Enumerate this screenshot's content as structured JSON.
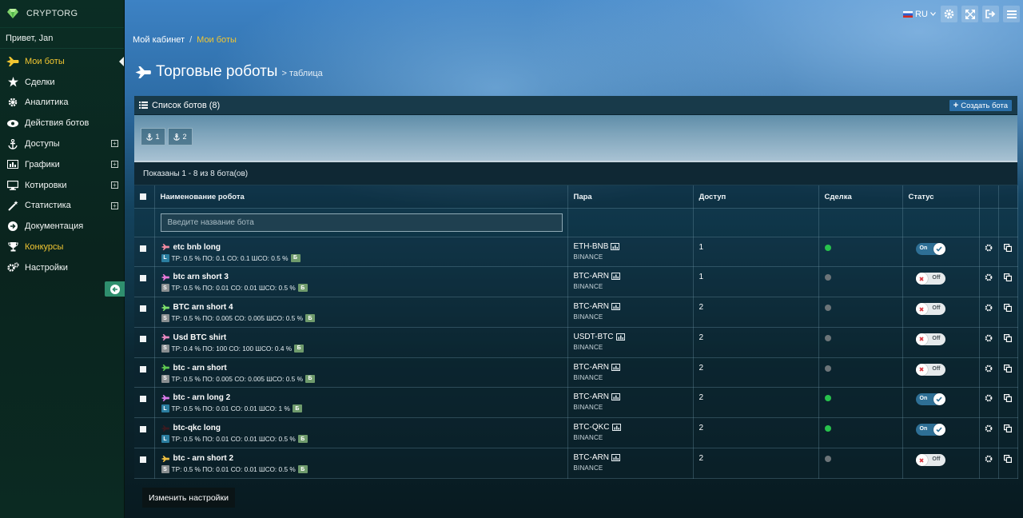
{
  "brand": {
    "name": "CRYPTORG"
  },
  "user": {
    "greeting": "Привет, Jan"
  },
  "sidebar": {
    "items": [
      {
        "label": "Мои боты"
      },
      {
        "label": "Сделки"
      },
      {
        "label": "Аналитика"
      },
      {
        "label": "Действия ботов"
      },
      {
        "label": "Доступы"
      },
      {
        "label": "Графики"
      },
      {
        "label": "Котировки"
      },
      {
        "label": "Статистика"
      },
      {
        "label": "Документация"
      },
      {
        "label": "Конкурсы"
      },
      {
        "label": "Настройки"
      }
    ]
  },
  "topbar": {
    "lang": "RU"
  },
  "breadcrumb": {
    "home": "Мой кабинет",
    "sep": "/",
    "current": "Мои боты"
  },
  "page": {
    "title": "Торговые роботы",
    "subtitle": "> таблица"
  },
  "panel": {
    "title": "Список ботов (8)",
    "create_label": "Создать бота",
    "groups": [
      {
        "label": "1"
      },
      {
        "label": "2"
      }
    ],
    "shown_text": "Показаны 1 - 8 из 8 бота(ов)",
    "apply_label": "Изменить настройки"
  },
  "table": {
    "headers": {
      "name": "Наименование робота",
      "pair": "Пара",
      "access": "Доступ",
      "deal": "Сделка",
      "status": "Статус"
    },
    "search_placeholder": "Введите название бота",
    "rows": [
      {
        "name": "etc bnb long",
        "side": "L",
        "params": "TP: 0.5 % ПО: 0.1 СО: 0.1 ШСО: 0.5 %",
        "badge": "Б",
        "pair": "ETH-BNB",
        "exchange": "BINANCE",
        "access": "1",
        "deal_color": "#27c24c",
        "status": "On",
        "plane_color": "#f08aa0"
      },
      {
        "name": "btc arn short 3",
        "side": "S",
        "params": "TP: 0.5 % ПО: 0.01 СО: 0.01 ШСО: 0.5 %",
        "badge": "Б",
        "pair": "BTC-ARN",
        "exchange": "BINANCE",
        "access": "1",
        "deal_color": "#6c7478",
        "status": "Off",
        "plane_color": "#e878d8"
      },
      {
        "name": "BTC arn short 4",
        "side": "S",
        "params": "TP: 0.5 % ПО: 0.005 СО: 0.005 ШСО: 0.5 %",
        "badge": "Б",
        "pair": "BTC-ARN",
        "exchange": "BINANCE",
        "access": "2",
        "deal_color": "#6c7478",
        "status": "Off",
        "plane_color": "#7ee06a"
      },
      {
        "name": "Usd BTC shirt",
        "side": "S",
        "params": "TP: 0.4 % ПО: 100 СО: 100 ШСО: 0.4 %",
        "badge": "Б",
        "pair": "USDT-BTC",
        "exchange": "BINANCE",
        "access": "2",
        "deal_color": "#6c7478",
        "status": "Off",
        "plane_color": "#e888c0"
      },
      {
        "name": "btc - arn short",
        "side": "S",
        "params": "TP: 0.5 % ПО: 0.005 СО: 0.005 ШСО: 0.5 %",
        "badge": "Б",
        "pair": "BTC-ARN",
        "exchange": "BINANCE",
        "access": "2",
        "deal_color": "#6c7478",
        "status": "Off",
        "plane_color": "#5fc850"
      },
      {
        "name": "btc - arn long 2",
        "side": "L",
        "params": "TP: 0.5 % ПО: 0.01 СО: 0.01 ШСО: 1 %",
        "badge": "Б",
        "pair": "BTC-ARN",
        "exchange": "BINANCE",
        "access": "2",
        "deal_color": "#27c24c",
        "status": "On",
        "plane_color": "#d87ae8"
      },
      {
        "name": "btc-qkc long",
        "side": "L",
        "params": "TP: 0.5 % ПО: 0.01 СО: 0.01 ШСО: 0.5 %",
        "badge": "Б",
        "pair": "BTC-QKC",
        "exchange": "BINANCE",
        "access": "2",
        "deal_color": "#27c24c",
        "status": "On",
        "plane_color": "#3a1a20"
      },
      {
        "name": "btc - arn short 2",
        "side": "S",
        "params": "TP: 0.5 % ПО: 0.01 СО: 0.01 ШСО: 0.5 %",
        "badge": "Б",
        "pair": "BTC-ARN",
        "exchange": "BINANCE",
        "access": "2",
        "deal_color": "#6c7478",
        "status": "Off",
        "plane_color": "#f0c040"
      }
    ]
  }
}
